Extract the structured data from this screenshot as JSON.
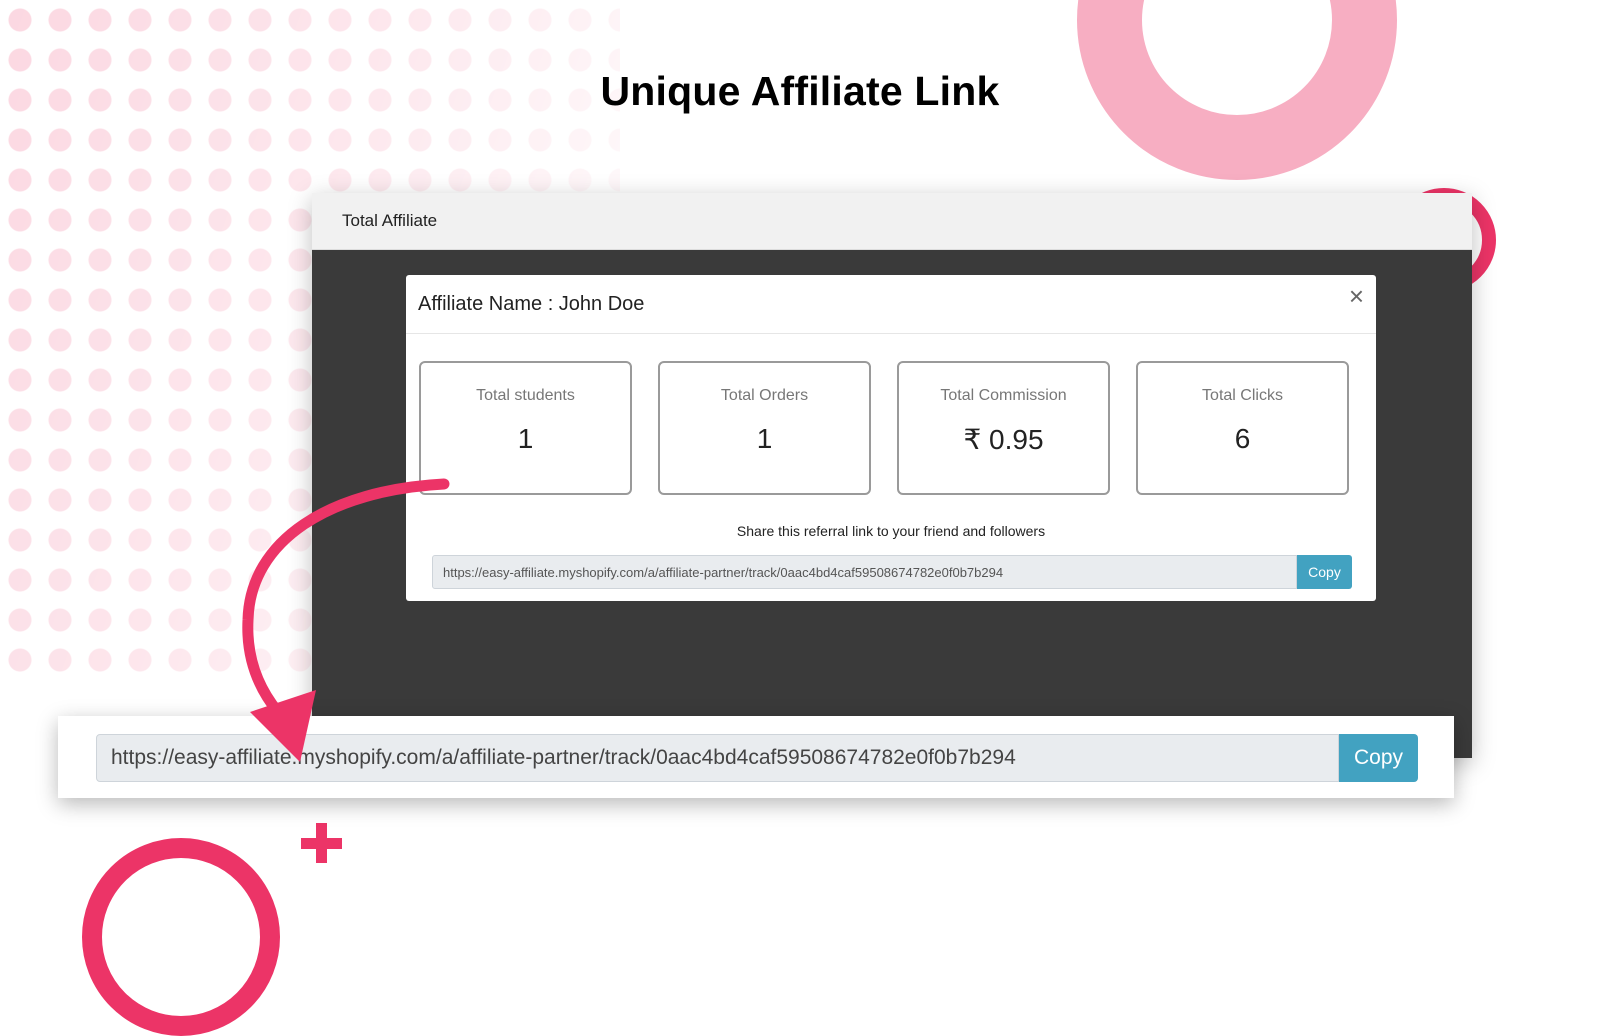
{
  "slide": {
    "title": "Unique Affiliate Link"
  },
  "app": {
    "header_title": "Total Affiliate"
  },
  "modal": {
    "title": "Affiliate Name : John Doe",
    "close_symbol": "×",
    "stats": [
      {
        "label": "Total students",
        "value": "1"
      },
      {
        "label": "Total Orders",
        "value": "1"
      },
      {
        "label": "Total Commission",
        "value": "₹ 0.95"
      },
      {
        "label": "Total Clicks",
        "value": "6"
      }
    ],
    "share_text": "Share this referral link to your friend and followers",
    "link_value": "https://easy-affiliate.myshopify.com/a/affiliate-partner/track/0aac4bd4caf59508674782e0f0b7b294",
    "copy_label": "Copy"
  },
  "zoom": {
    "link_value": "https://easy-affiliate.myshopify.com/a/affiliate-partner/track/0aac4bd4caf59508674782e0f0b7b294",
    "copy_label": "Copy"
  },
  "colors": {
    "accent_pink": "#ec3467",
    "light_pink": "#f7aec2",
    "button_blue": "#42a2c1",
    "overlay_dark": "#3a3a3a"
  },
  "icons": [
    "close-icon",
    "curved-arrow-icon",
    "plus-icon"
  ]
}
